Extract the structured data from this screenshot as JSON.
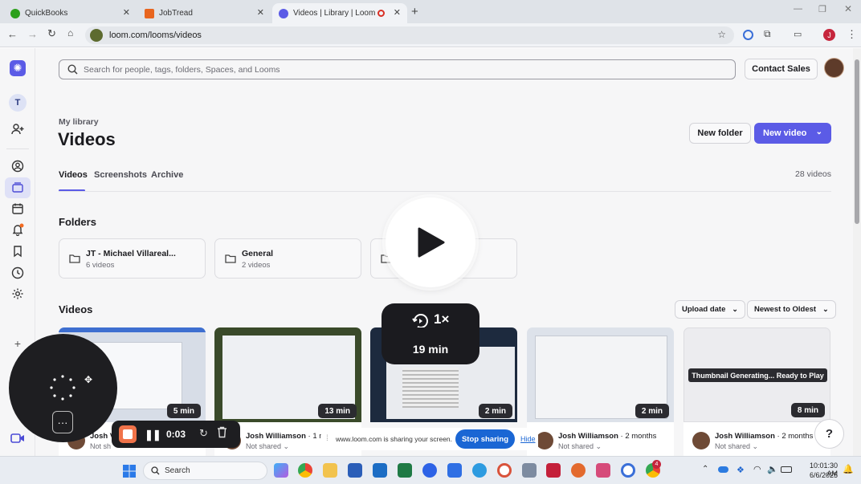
{
  "browser": {
    "tabs": [
      {
        "title": "QuickBooks",
        "favicon_color": "#2ca01c"
      },
      {
        "title": "JobTread",
        "favicon_color": "#e8651e"
      },
      {
        "title": "Videos | Library | Loom",
        "favicon_color": "#5b5be6",
        "active": true
      }
    ],
    "url": "loom.com/looms/videos",
    "profile_initial": "J"
  },
  "sidebar": {
    "workspace_initial": "T",
    "items": [
      "logo-icon",
      "workspace-avatar",
      "invite-icon",
      "profile-icon",
      "library-icon",
      "calendar-icon",
      "notifications-icon",
      "bookmark-icon",
      "history-icon",
      "settings-icon",
      "plus-icon",
      "record-icon"
    ]
  },
  "header": {
    "search_placeholder": "Search for people, tags, folders, Spaces, and Looms",
    "contact_sales": "Contact Sales"
  },
  "library": {
    "breadcrumb": "My library",
    "title": "Videos",
    "new_folder": "New folder",
    "new_video": "New video",
    "tabs": [
      "Videos",
      "Screenshots",
      "Archive"
    ],
    "count": "28 videos",
    "folders_heading": "Folders",
    "folders": [
      {
        "name": "JT - Michael Villareal...",
        "count": "6 videos"
      },
      {
        "name": "General",
        "count": "2 videos"
      }
    ],
    "videos_heading": "Videos",
    "sort_field": "Upload date",
    "sort_order": "Newest to Oldest",
    "videos": [
      {
        "duration": "5 min",
        "author": "Josh V",
        "ago": "",
        "shared": "Not sh"
      },
      {
        "duration": "13 min",
        "author": "Josh Williamson",
        "ago": "· 1 mo",
        "shared": "Not shared"
      },
      {
        "duration": "2 min",
        "author": "",
        "ago": "",
        "shared": ""
      },
      {
        "duration": "2 min",
        "author": "Josh Williamson",
        "ago": "· 2 months",
        "shared": "Not shared"
      },
      {
        "duration": "8 min",
        "author": "Josh Williamson",
        "ago": "· 2 months",
        "shared": "Not shared",
        "thumb_text": "Thumbnail Generating... Ready to Play"
      }
    ]
  },
  "player_overlay": {
    "speed": "1×",
    "length": "19 min"
  },
  "recorder": {
    "elapsed": "0:03"
  },
  "share_bar": {
    "message": "www.loom.com is sharing your screen.",
    "stop": "Stop sharing",
    "hide": "Hide"
  },
  "help": "?",
  "taskbar": {
    "search": "Search",
    "time": "10:01:30 AM",
    "date": "6/6/2025",
    "badge": "4"
  }
}
